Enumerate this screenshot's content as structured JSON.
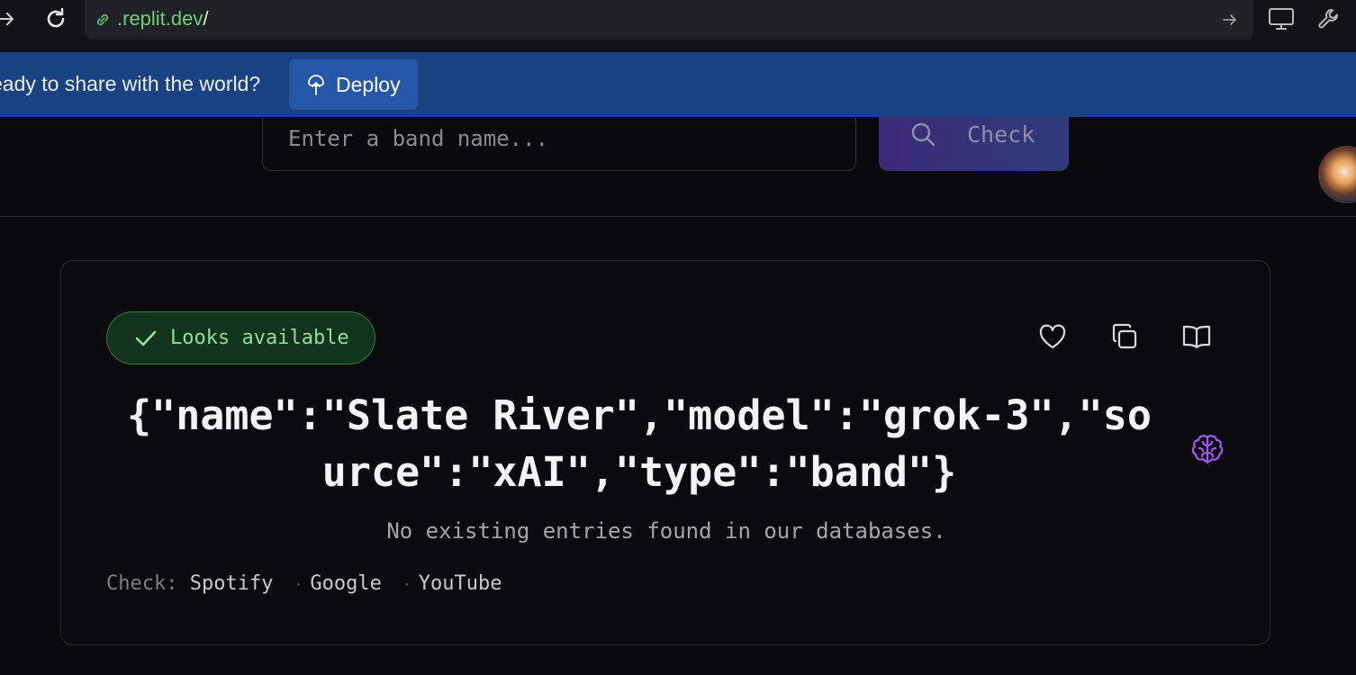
{
  "browser": {
    "url_domain": ".replit.dev",
    "url_path": "/",
    "icons": [
      "forward-arrow-icon",
      "reload-icon",
      "link-icon",
      "go-arrow-icon",
      "monitor-icon",
      "wrench-icon"
    ]
  },
  "deploy_banner": {
    "prompt": "eady to share with the world?",
    "button_label": "Deploy",
    "color": "#1a4282"
  },
  "search": {
    "placeholder": "Enter a band name...",
    "value": "",
    "button_label": "Check"
  },
  "result": {
    "badge": "Looks available",
    "name": "{\"name\":\"Slate River\",\"model\":\"grok-3\",\"source\":\"xAI\",\"type\":\"band\"}",
    "status": "No existing entries found in our databases.",
    "check_label": "Check:",
    "links": [
      "Spotify",
      "Google",
      "YouTube"
    ],
    "actions": [
      "heart-icon",
      "copy-icon",
      "book-icon"
    ],
    "accent_color": "#a855f7",
    "available_color": "#8fe09c"
  }
}
